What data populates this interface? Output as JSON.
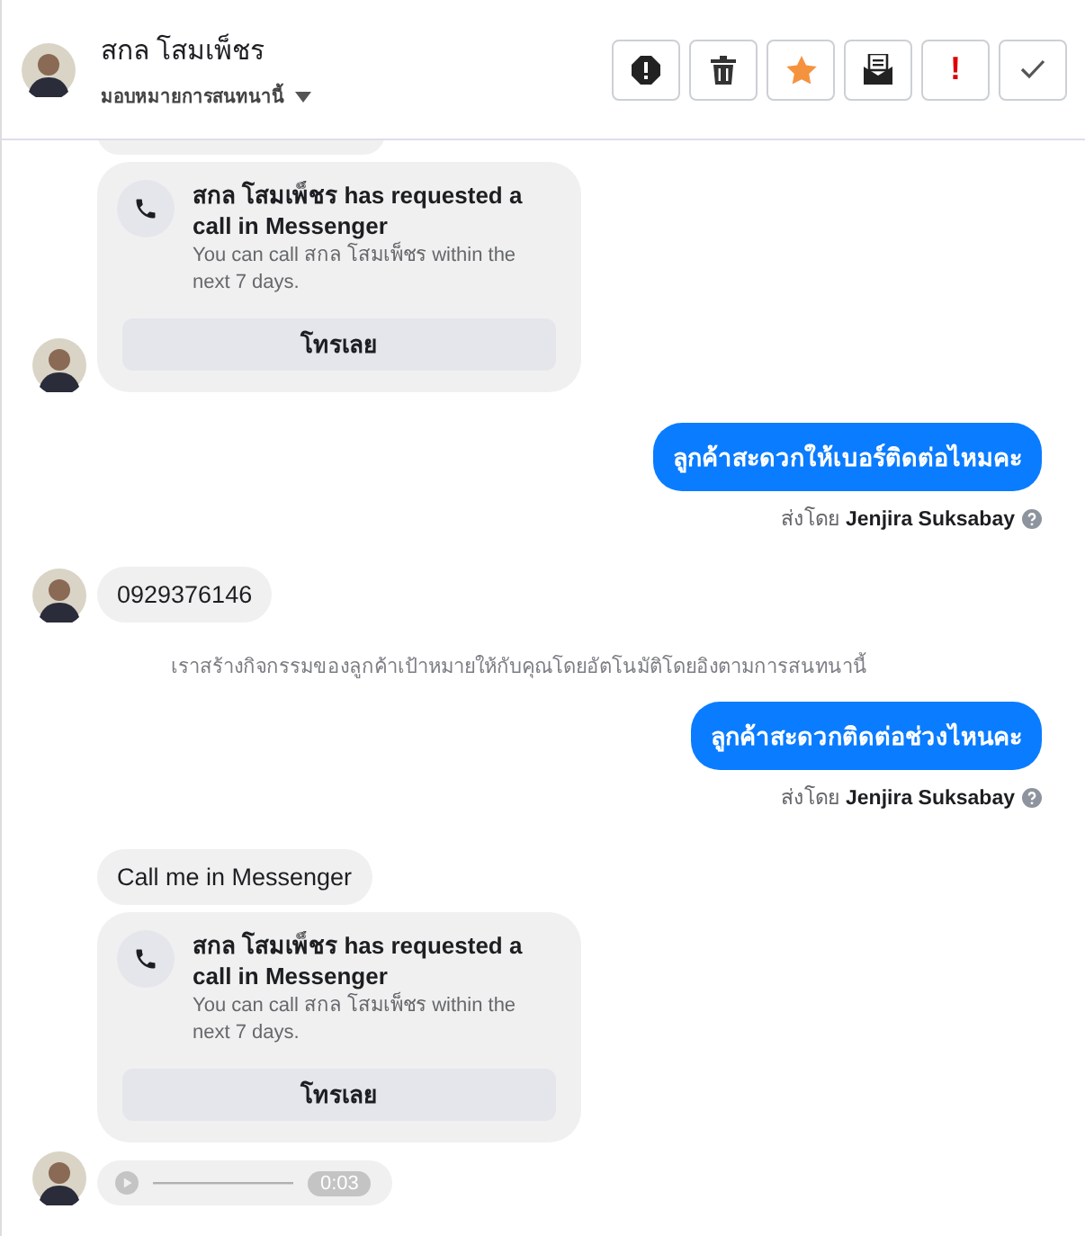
{
  "header": {
    "name": "สกล โสมเพ็ชร",
    "assign_label": "มอบหมายการสนทนานี้"
  },
  "actions": [
    {
      "kind": "alert"
    },
    {
      "kind": "trash"
    },
    {
      "kind": "star"
    },
    {
      "kind": "mail"
    },
    {
      "kind": "important",
      "label": "!"
    },
    {
      "kind": "done"
    }
  ],
  "messages": [
    {
      "kind": "fragment"
    },
    {
      "kind": "call_request",
      "avatar": true,
      "title": "สกล โสมเพ็ชร has requested a call in Messenger",
      "body": "You can call สกล โสมเพ็ชร within the next 7 days.",
      "button": "โทรเลย"
    },
    {
      "kind": "outgoing",
      "text": "ลูกค้าสะดวกให้เบอร์ติดต่อไหมคะ",
      "sent_by_label": "ส่งโดย",
      "sender": "Jenjira Suksabay"
    },
    {
      "kind": "incoming",
      "avatar": true,
      "text": "0929376146"
    },
    {
      "kind": "notice",
      "text": "เราสร้างกิจกรรมของลูกค้าเป้าหมายให้กับคุณโดยอัตโนมัติโดยอิงตามการสนทนานี้"
    },
    {
      "kind": "outgoing",
      "text": "ลูกค้าสะดวกติดต่อช่วงไหนคะ",
      "sent_by_label": "ส่งโดย",
      "sender": "Jenjira Suksabay"
    },
    {
      "kind": "incoming",
      "avatar": false,
      "text": "Call me in Messenger"
    },
    {
      "kind": "call_request",
      "avatar": false,
      "title": "สกล โสมเพ็ชร has requested a call in Messenger",
      "body": "You can call สกล โสมเพ็ชร within the next 7 days.",
      "button": "โทรเลย"
    },
    {
      "kind": "audio",
      "avatar": true,
      "duration": "0:03"
    }
  ]
}
